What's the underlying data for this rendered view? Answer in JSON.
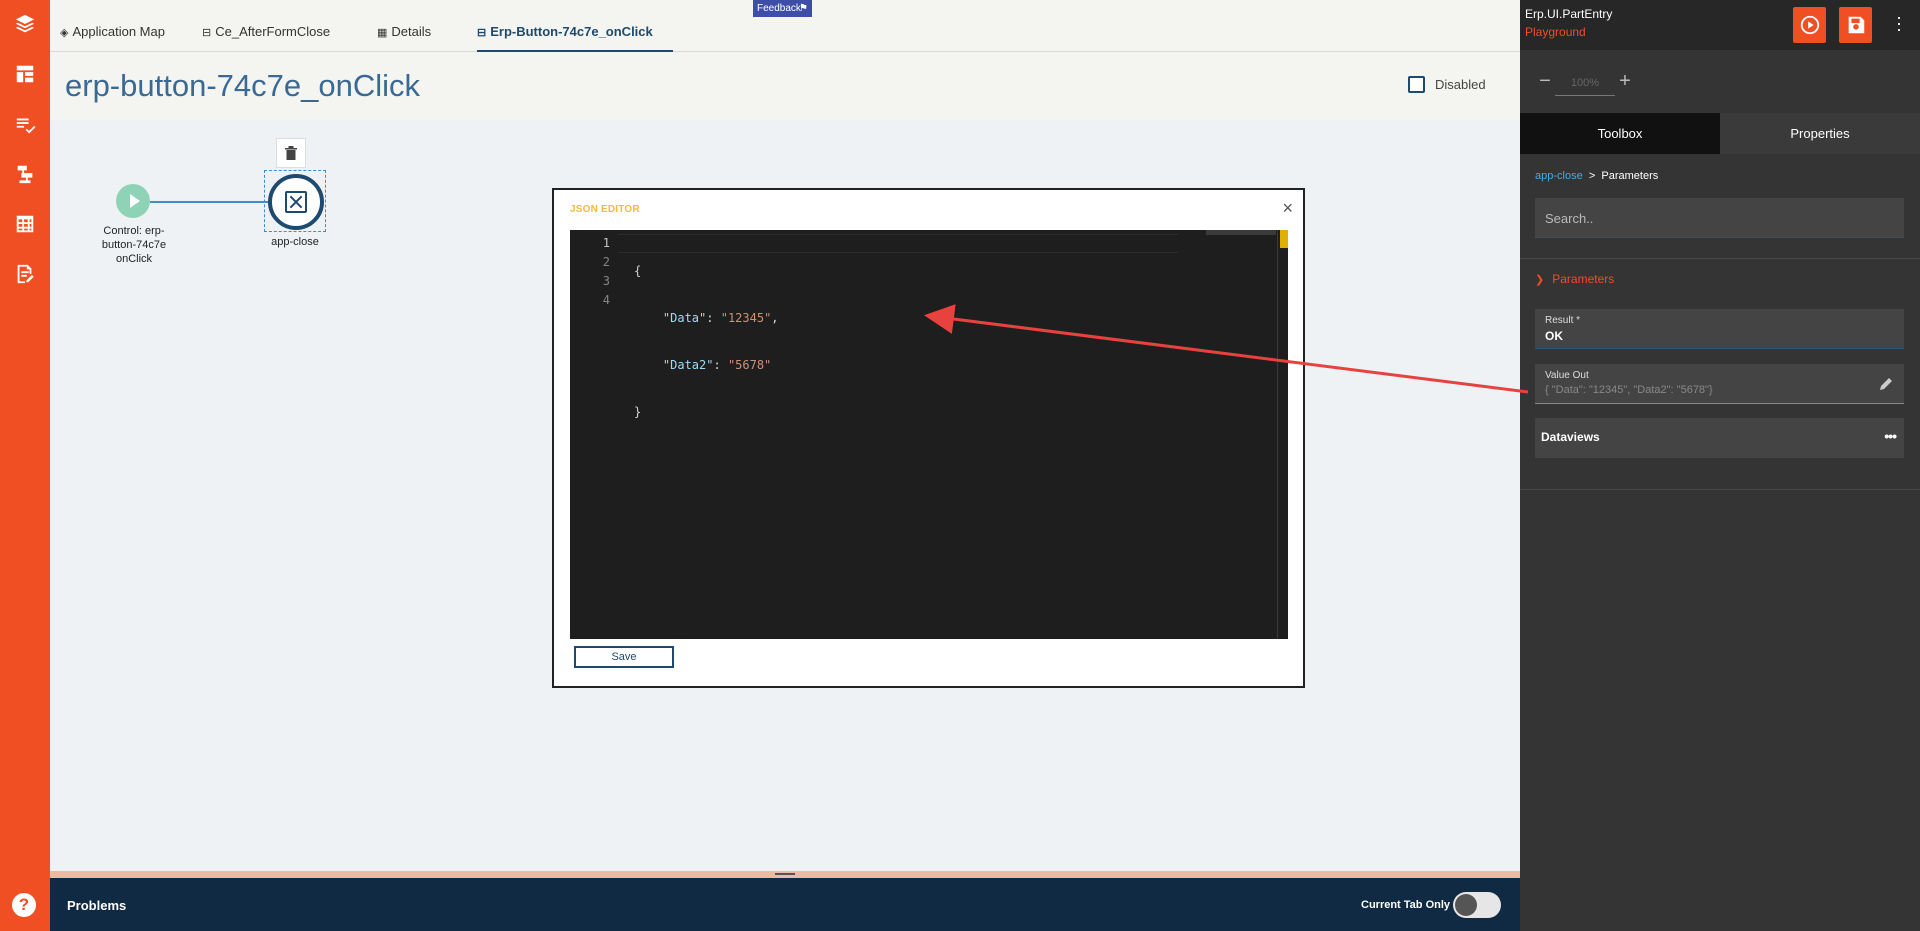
{
  "tabs": [
    {
      "label": "Application Map",
      "icon": "layers-icon"
    },
    {
      "label": "Ce_AfterFormClose",
      "icon": "flow-icon"
    },
    {
      "label": "Details",
      "icon": "table-icon"
    },
    {
      "label": "Erp-Button-74c7e_onClick",
      "icon": "flow-icon",
      "active": true
    }
  ],
  "feedback_label": "Feedback",
  "page_title": "erp-button-74c7e_onClick",
  "disabled_label": "Disabled",
  "nodes": {
    "start_label": "Control: erp-button-74c7e onClick",
    "close_label": "app-close"
  },
  "dialog": {
    "title": "JSON EDITOR",
    "close": "×",
    "line_numbers": [
      "1",
      "2",
      "3",
      "4"
    ],
    "code": {
      "line1": "{",
      "key1": "\"Data\"",
      "val1": "\"12345\"",
      "key2": "\"Data2\"",
      "val2": "\"5678\"",
      "line4": "}"
    },
    "save_label": "Save"
  },
  "problems": {
    "title": "Problems",
    "current_tab_only": "Current Tab Only"
  },
  "right_panel": {
    "app_name": "Erp.UI.PartEntry",
    "app_env": "Playground",
    "zoom_minus": "−",
    "zoom_value": "100%",
    "zoom_plus": "+",
    "tab_toolbox": "Toolbox",
    "tab_properties": "Properties",
    "crumb_link": "app-close",
    "crumb_sep": ">",
    "crumb_current": "Parameters",
    "search_placeholder": "Search..",
    "section_parameters": "Parameters",
    "result_label": "Result *",
    "result_value": "OK",
    "value_out_label": "Value Out",
    "value_out_value": "{ \"Data\": \"12345\", \"Data2\": \"5678\"}",
    "dataviews_label": "Dataviews"
  },
  "colors": {
    "accent": "#f04e23",
    "navy": "#1d4a6e",
    "arrow": "#e8423f"
  }
}
